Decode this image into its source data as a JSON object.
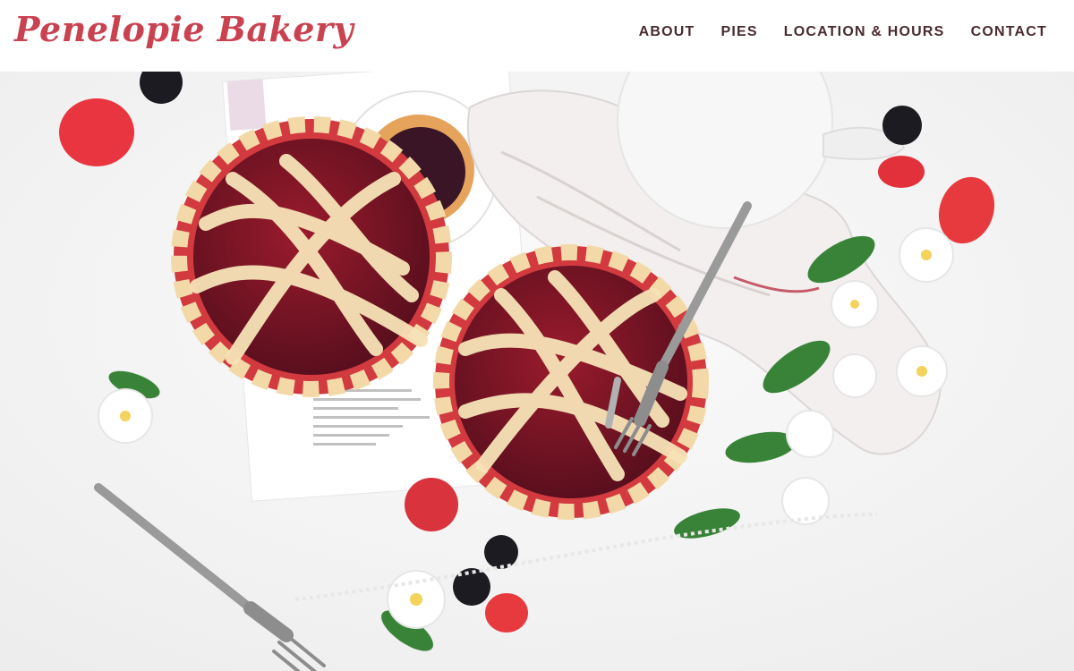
{
  "header": {
    "logo_text": "Penelopie Bakery",
    "nav": [
      {
        "label": "ABOUT"
      },
      {
        "label": "PIES"
      },
      {
        "label": "LOCATION & HOURS"
      },
      {
        "label": "CONTACT"
      }
    ]
  },
  "colors": {
    "brand": "#c9424f",
    "nav_text": "#4a2a2f",
    "background": "#ffffff"
  },
  "hero": {
    "image_description_icon": "berry-pies-photo"
  }
}
